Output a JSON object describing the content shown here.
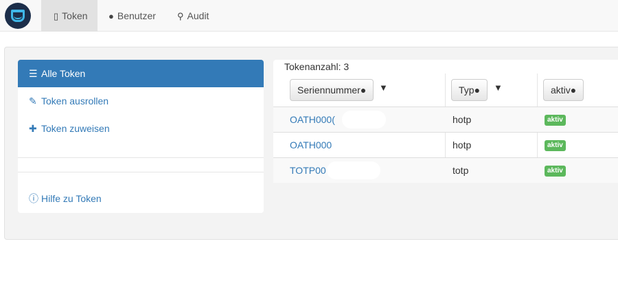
{
  "nav": {
    "items": [
      {
        "label": "Token",
        "icon": "phone-icon"
      },
      {
        "label": "Benutzer",
        "icon": "user-icon"
      },
      {
        "label": "Audit",
        "icon": "search-icon"
      }
    ]
  },
  "sidebar": {
    "items": [
      {
        "label": "Alle Token",
        "icon": "list-icon"
      },
      {
        "label": "Token ausrollen",
        "icon": "edit-icon"
      },
      {
        "label": "Token zuweisen",
        "icon": "plus-icon"
      }
    ],
    "help_label": "Hilfe zu Token"
  },
  "tokens": {
    "count_label": "Tokenanzahl: 3",
    "headers": {
      "serial": "Seriennummer",
      "type": "Typ",
      "active": "aktiv"
    },
    "rows": [
      {
        "serial": "OATH000(",
        "type": "hotp",
        "status": "aktiv"
      },
      {
        "serial": "OATH000",
        "type": "hotp",
        "status": "aktiv"
      },
      {
        "serial": "TOTP00",
        "type": "totp",
        "status": "aktiv"
      }
    ]
  },
  "colors": {
    "primary": "#337ab7",
    "success": "#5cb85c",
    "navbar": "#f8f8f8"
  }
}
